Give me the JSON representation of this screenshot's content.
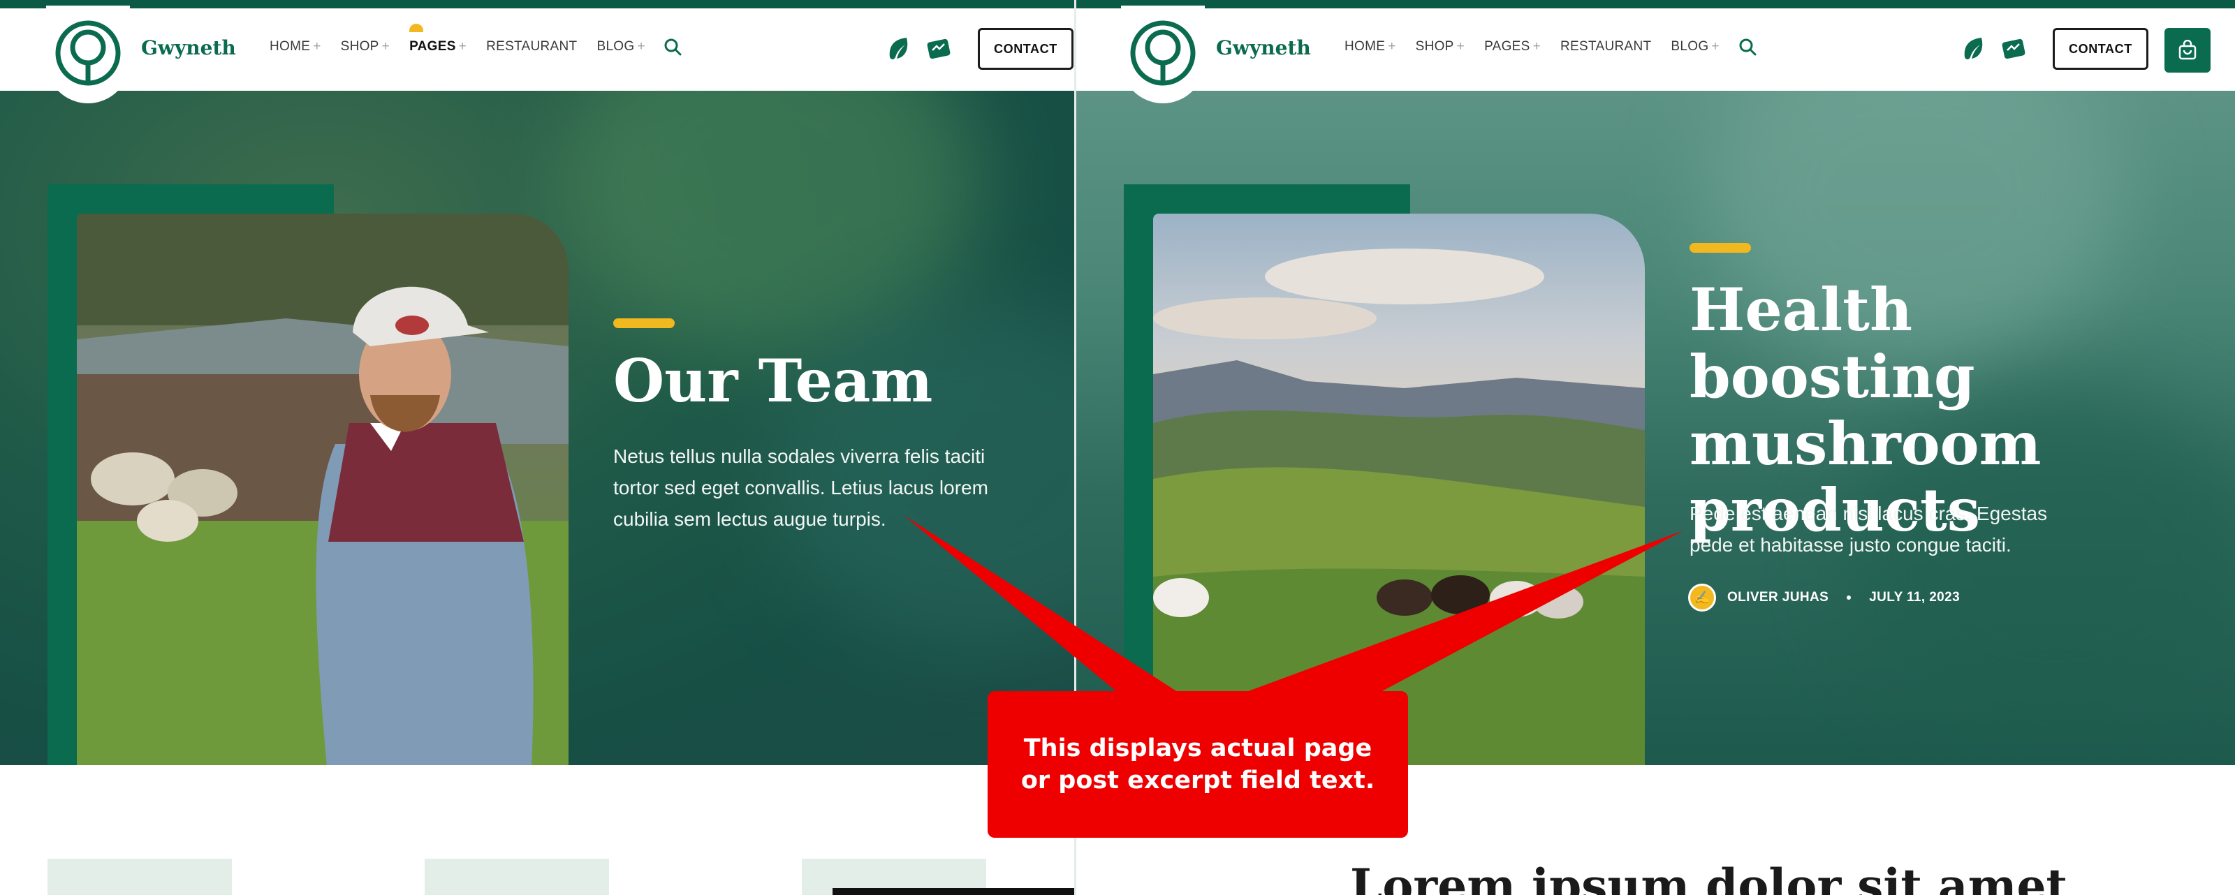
{
  "brand": {
    "name": "Gwyneth"
  },
  "nav": {
    "items": [
      {
        "label": "HOME",
        "has_submenu": true
      },
      {
        "label": "SHOP",
        "has_submenu": true
      },
      {
        "label": "PAGES",
        "has_submenu": true
      },
      {
        "label": "RESTAURANT",
        "has_submenu": false
      },
      {
        "label": "BLOG",
        "has_submenu": true
      }
    ],
    "plus": "+"
  },
  "header": {
    "contact_label": "CONTACT"
  },
  "left_hero": {
    "title": "Our Team",
    "excerpt": "Netus tellus nulla sodales viverra felis taciti tortor sed eget convallis. Letius lacus lorem cubilia sem lectus augue turpis."
  },
  "right_hero": {
    "title": "Health boosting mushroom products",
    "excerpt": "Pede est aenean nisl lacus cras. Egestas pede et habitasse justo congue taciti.",
    "author": "OLIVER JUHAS",
    "date": "JULY 11, 2023"
  },
  "below": {
    "heading": "Lorem ipsum dolor sit amet"
  },
  "callout": {
    "text": "This displays actual page or post excerpt field text."
  },
  "colors": {
    "brand_green": "#0b6b4f",
    "accent_yellow": "#f2b820",
    "callout_red": "#ee0000"
  }
}
